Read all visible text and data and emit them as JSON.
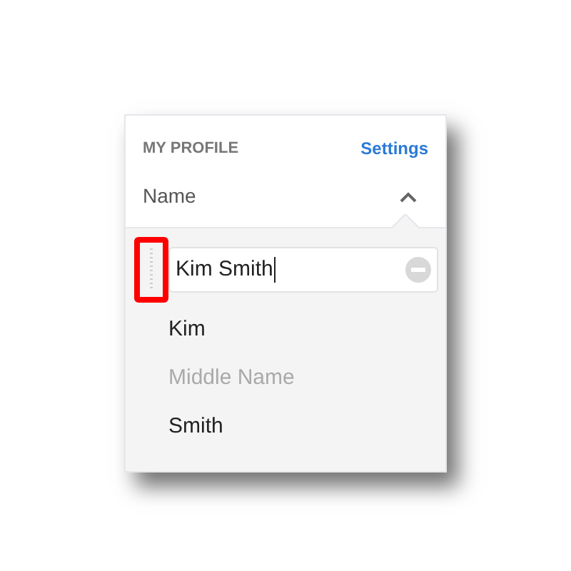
{
  "panel": {
    "title": "MY PROFILE",
    "link": "Settings"
  },
  "section": {
    "label": "Name",
    "expanded": true
  },
  "name_field": {
    "value": "Kim Smith",
    "handle_highlighted": true
  },
  "parts": [
    {
      "kind": "value",
      "text": "Kim"
    },
    {
      "kind": "placeholder",
      "text": "Middle Name"
    },
    {
      "kind": "value",
      "text": "Smith"
    }
  ]
}
